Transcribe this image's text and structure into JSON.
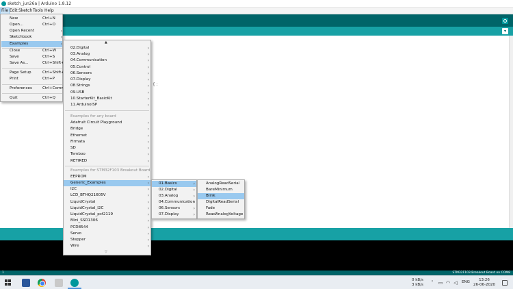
{
  "window": {
    "title": "sketch_jun26a | Arduino 1.8.12"
  },
  "menubar": [
    "File",
    "Edit",
    "Sketch",
    "Tools",
    "Help"
  ],
  "file_menu": [
    {
      "label": "New",
      "shortcut": "Ctrl+N"
    },
    {
      "label": "Open...",
      "shortcut": "Ctrl+O"
    },
    {
      "label": "Open Recent",
      "shortcut": "",
      "submenu": true
    },
    {
      "label": "Sketchbook",
      "shortcut": "",
      "submenu": true
    },
    {
      "label": "Examples",
      "shortcut": "",
      "submenu": true,
      "highlighted": true
    },
    {
      "label": "Close",
      "shortcut": "Ctrl+W"
    },
    {
      "label": "Save",
      "shortcut": "Ctrl+S"
    },
    {
      "label": "Save As...",
      "shortcut": "Ctrl+Shift+S"
    },
    {
      "label": "Page Setup",
      "shortcut": "Ctrl+Shift+P"
    },
    {
      "label": "Print",
      "shortcut": "Ctrl+P"
    },
    {
      "label": "Preferences",
      "shortcut": "Ctrl+Comma"
    },
    {
      "label": "Quit",
      "shortcut": "Ctrl+Q"
    }
  ],
  "examples_menu": {
    "builtin": [
      "02.Digital",
      "03.Analog",
      "04.Communication",
      "05.Control",
      "06.Sensors",
      "07.Display",
      "08.Strings",
      "09.USB",
      "10.StarterKit_BasicKit",
      "11.ArduinoISP"
    ],
    "any_board_header": "Examples for any board",
    "any_board": [
      "Adafruit Circuit Playground",
      "Bridge",
      "Ethernet",
      "Firmata",
      "SD",
      "Temboo",
      "RETIRED"
    ],
    "board_header": "Examples for STM32F103 Breakout Board",
    "board": [
      "EEPROM",
      "Generic_Examples",
      "I2C",
      "LCD_BTHQ21605V",
      "LiquidCrystal",
      "LiquidCrystal_I2C",
      "LiquidCrystal_pcf2119",
      "Mini_SSD1306",
      "PCD8544",
      "Servo",
      "Stepper",
      "Wire"
    ],
    "scroll_up": "▲",
    "scroll_down": "▽"
  },
  "generic_examples_menu": [
    "01.Basics",
    "02.Digital",
    "03.Analog",
    "04.Communication",
    "06.Sensors",
    "07.Display"
  ],
  "basics_menu": [
    "AnalogReadSerial",
    "BareMinimum",
    "Blink",
    "DigitalReadSerial",
    "Fade",
    "ReadAnalogVoltage"
  ],
  "editor": {
    "caret_text": "{ :"
  },
  "statusbar": {
    "line": "1",
    "board": "STM32F103 Breakout Board on COM8"
  },
  "taskbar": {
    "net_up": "0 kB/s",
    "net_down": "3 kB/s",
    "language": "ENG",
    "time": "13:26",
    "date": "26-06-2020"
  },
  "colors": {
    "toolbar": "#006468",
    "tabstrip": "#17a1a5",
    "highlight": "#99c9ef"
  }
}
